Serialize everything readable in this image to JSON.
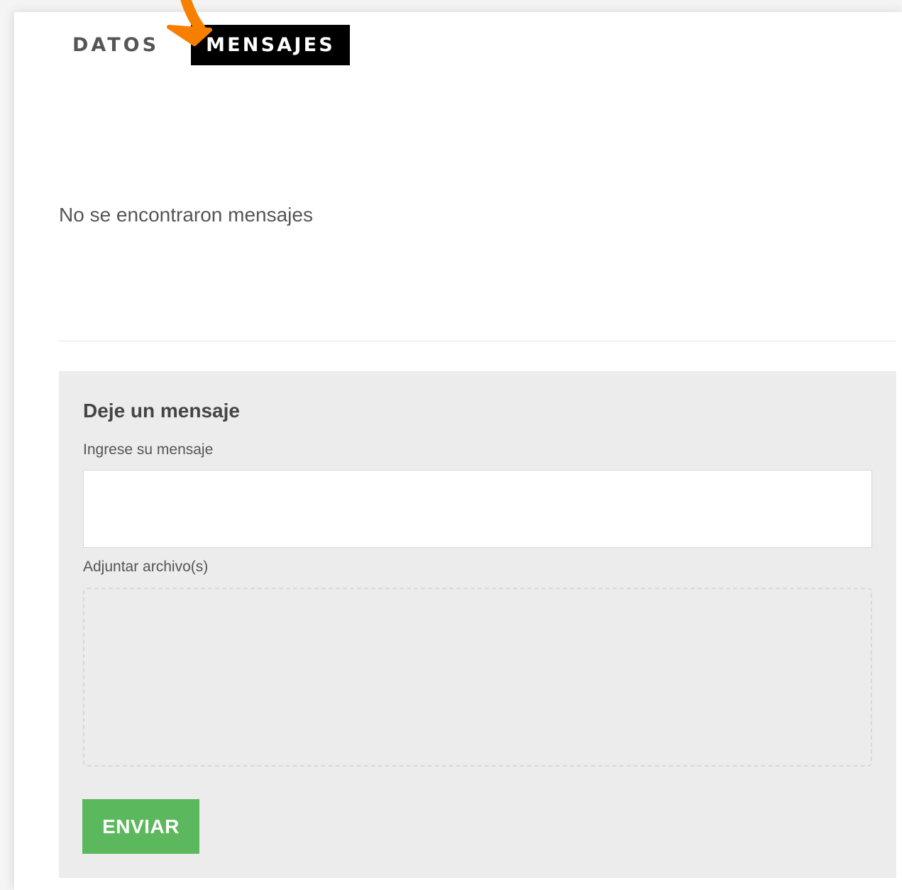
{
  "tabs": {
    "datos": "DATOS",
    "mensajes": "MENSAJES",
    "active": "mensajes"
  },
  "messages": {
    "empty_text": "No se encontraron mensajes"
  },
  "form": {
    "title": "Deje un mensaje",
    "message_label": "Ingrese su mensaje",
    "message_value": "",
    "attach_label": "Adjuntar archivo(s)",
    "submit_label": "ENVIAR"
  },
  "colors": {
    "active_tab_bg": "#000000",
    "submit_button": "#5cb85c",
    "annotation_arrow": "#f77f00",
    "form_background": "#ececec"
  },
  "icons": {
    "annotation": "pointer-arrow-icon"
  }
}
